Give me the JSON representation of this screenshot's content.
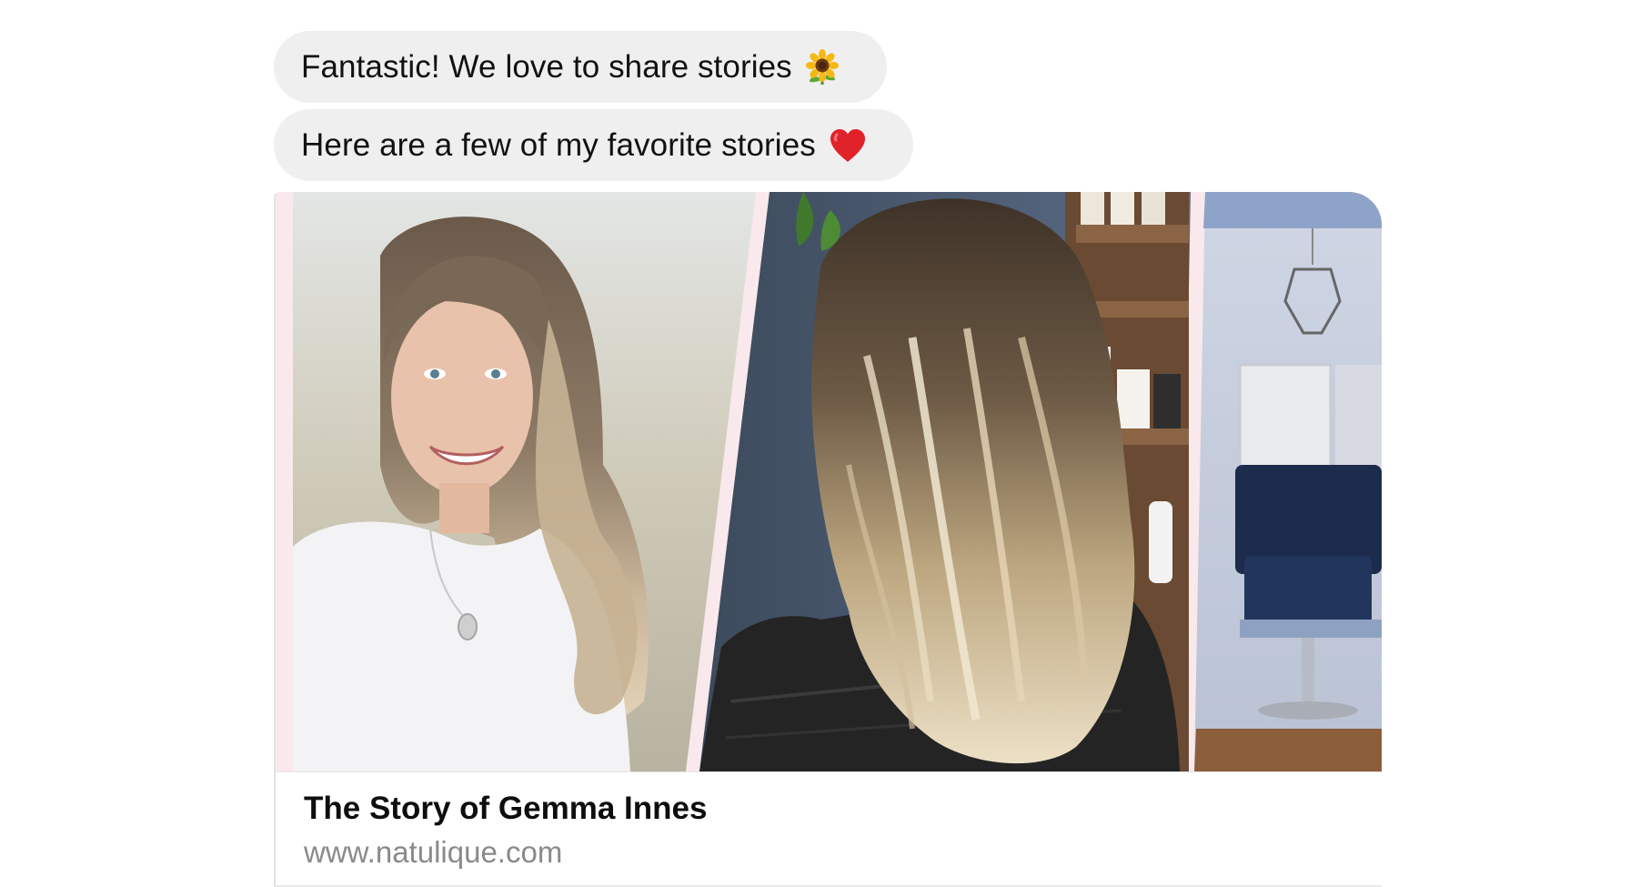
{
  "messages": [
    {
      "text": "Fantastic! We love to share stories",
      "emoji": "sunflower-icon"
    },
    {
      "text": "Here are a few of my favorite stories",
      "emoji": "red-heart-icon"
    }
  ],
  "card": {
    "title": "The Story of Gemma Innes",
    "url": "www.natulique.com",
    "panels": [
      "portrait-photo",
      "hair-back-photo",
      "salon-interior-photo"
    ]
  },
  "colors": {
    "bubble_bg": "#efefef",
    "card_border": "#e4e4e4",
    "url_gray": "#8a8a8a",
    "divider_pink": "#f9e9ec"
  }
}
